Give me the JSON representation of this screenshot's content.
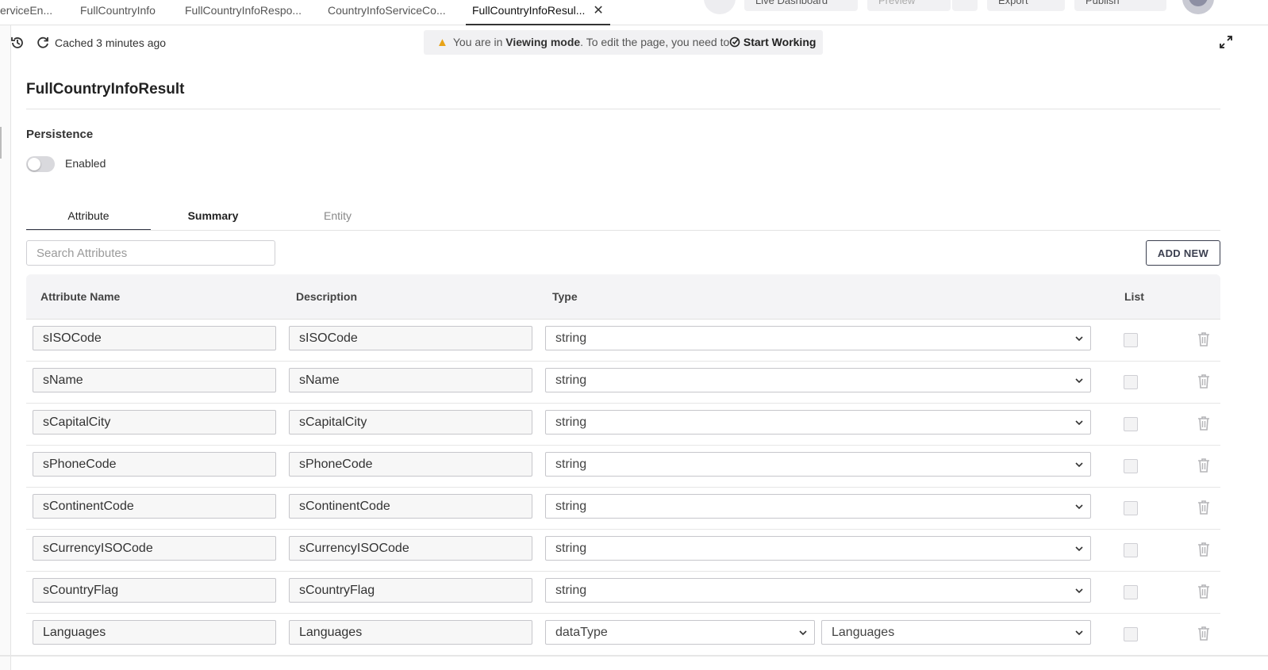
{
  "tabs": [
    {
      "label": "erviceEn..."
    },
    {
      "label": "FullCountryInfo"
    },
    {
      "label": "FullCountryInfoRespo..."
    },
    {
      "label": "CountryInfoServiceCo..."
    },
    {
      "label": "FullCountryInfoResul...",
      "active": true
    }
  ],
  "top_actions": {
    "dashboard": "Live Dashboard",
    "preview": "Preview",
    "export": "Export",
    "publish": "Publish"
  },
  "toolbar": {
    "cached_text": "Cached 3 minutes ago",
    "banner_prefix": "You are in ",
    "banner_mode": "Viewing mode",
    "banner_suffix": ". To edit the page, you need to",
    "start_working": "Start Working"
  },
  "page": {
    "title": "FullCountryInfoResult",
    "persistence_label": "Persistence",
    "enabled_label": "Enabled",
    "enabled": false
  },
  "section_tabs": [
    "Attribute",
    "Summary",
    "Entity"
  ],
  "search": {
    "placeholder": "Search Attributes"
  },
  "add_new_label": "ADD NEW",
  "table": {
    "headers": {
      "name": "Attribute Name",
      "description": "Description",
      "type": "Type",
      "list": "List"
    },
    "rows": [
      {
        "name": "sISOCode",
        "description": "sISOCode",
        "type": "string"
      },
      {
        "name": "sName",
        "description": "sName",
        "type": "string"
      },
      {
        "name": "sCapitalCity",
        "description": "sCapitalCity",
        "type": "string"
      },
      {
        "name": "sPhoneCode",
        "description": "sPhoneCode",
        "type": "string"
      },
      {
        "name": "sContinentCode",
        "description": "sContinentCode",
        "type": "string"
      },
      {
        "name": "sCurrencyISOCode",
        "description": "sCurrencyISOCode",
        "type": "string"
      },
      {
        "name": "sCountryFlag",
        "description": "sCountryFlag",
        "type": "string"
      },
      {
        "name": "Languages",
        "description": "Languages",
        "type": "dataType",
        "subtype": "Languages"
      }
    ]
  },
  "colors": {
    "accent": "#2f3342",
    "warning": "#e8a317",
    "banner_bg": "#f1f1f3"
  }
}
